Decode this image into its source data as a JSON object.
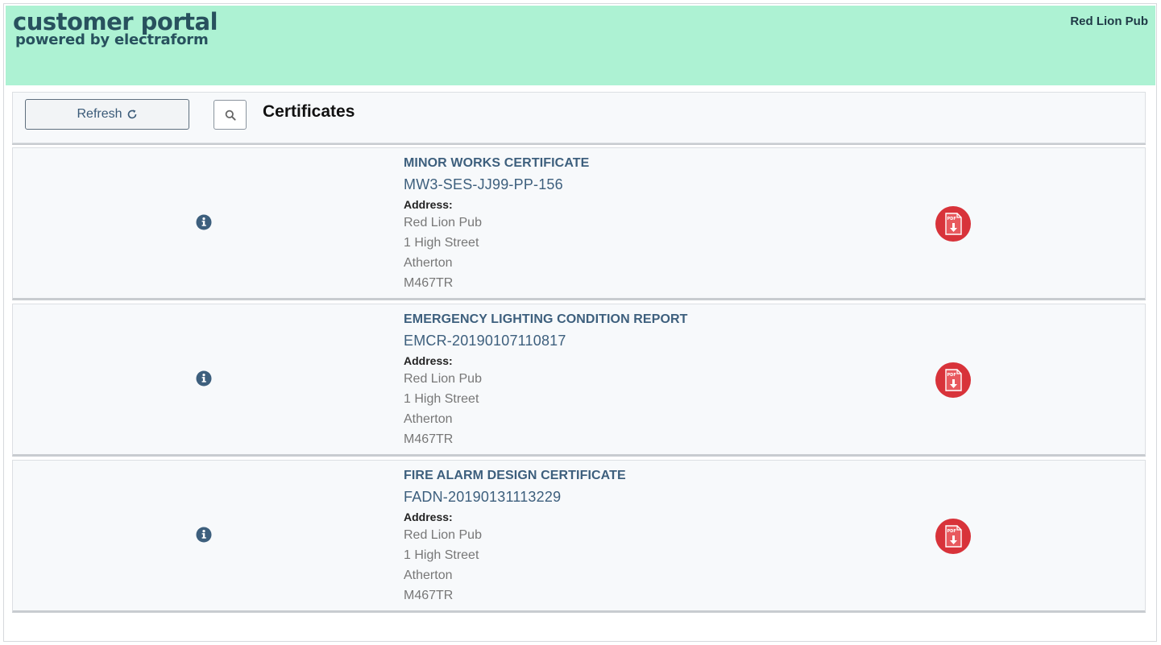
{
  "header": {
    "logo_main": "customer portal",
    "logo_sub": "powered by electraform",
    "account_name": "Red Lion Pub",
    "background": "#adf2d3"
  },
  "toolbar": {
    "refresh_label": "Refresh",
    "refresh_icon": "refresh-icon",
    "search_icon": "search-icon",
    "title": "Certificates"
  },
  "certificates": [
    {
      "type": "MINOR WORKS CERTIFICATE",
      "reference": "MW3-SES-JJ99-PP-156",
      "address_label": "Address:",
      "address": [
        "Red Lion Pub",
        "1 High Street",
        "Atherton",
        "M467TR"
      ],
      "info_icon": "info-icon",
      "download_icon": "pdf-download-icon"
    },
    {
      "type": "EMERGENCY LIGHTING CONDITION REPORT",
      "reference": "EMCR-20190107110817",
      "address_label": "Address:",
      "address": [
        "Red Lion Pub",
        "1 High Street",
        "Atherton",
        "M467TR"
      ],
      "info_icon": "info-icon",
      "download_icon": "pdf-download-icon"
    },
    {
      "type": "FIRE ALARM DESIGN CERTIFICATE",
      "reference": "FADN-20190131113229",
      "address_label": "Address:",
      "address": [
        "Red Lion Pub",
        "1 High Street",
        "Atherton",
        "M467TR"
      ],
      "info_icon": "info-icon",
      "download_icon": "pdf-download-icon"
    }
  ],
  "colors": {
    "accent_text": "#3d5f7d",
    "pdf_red": "#d8333a"
  }
}
